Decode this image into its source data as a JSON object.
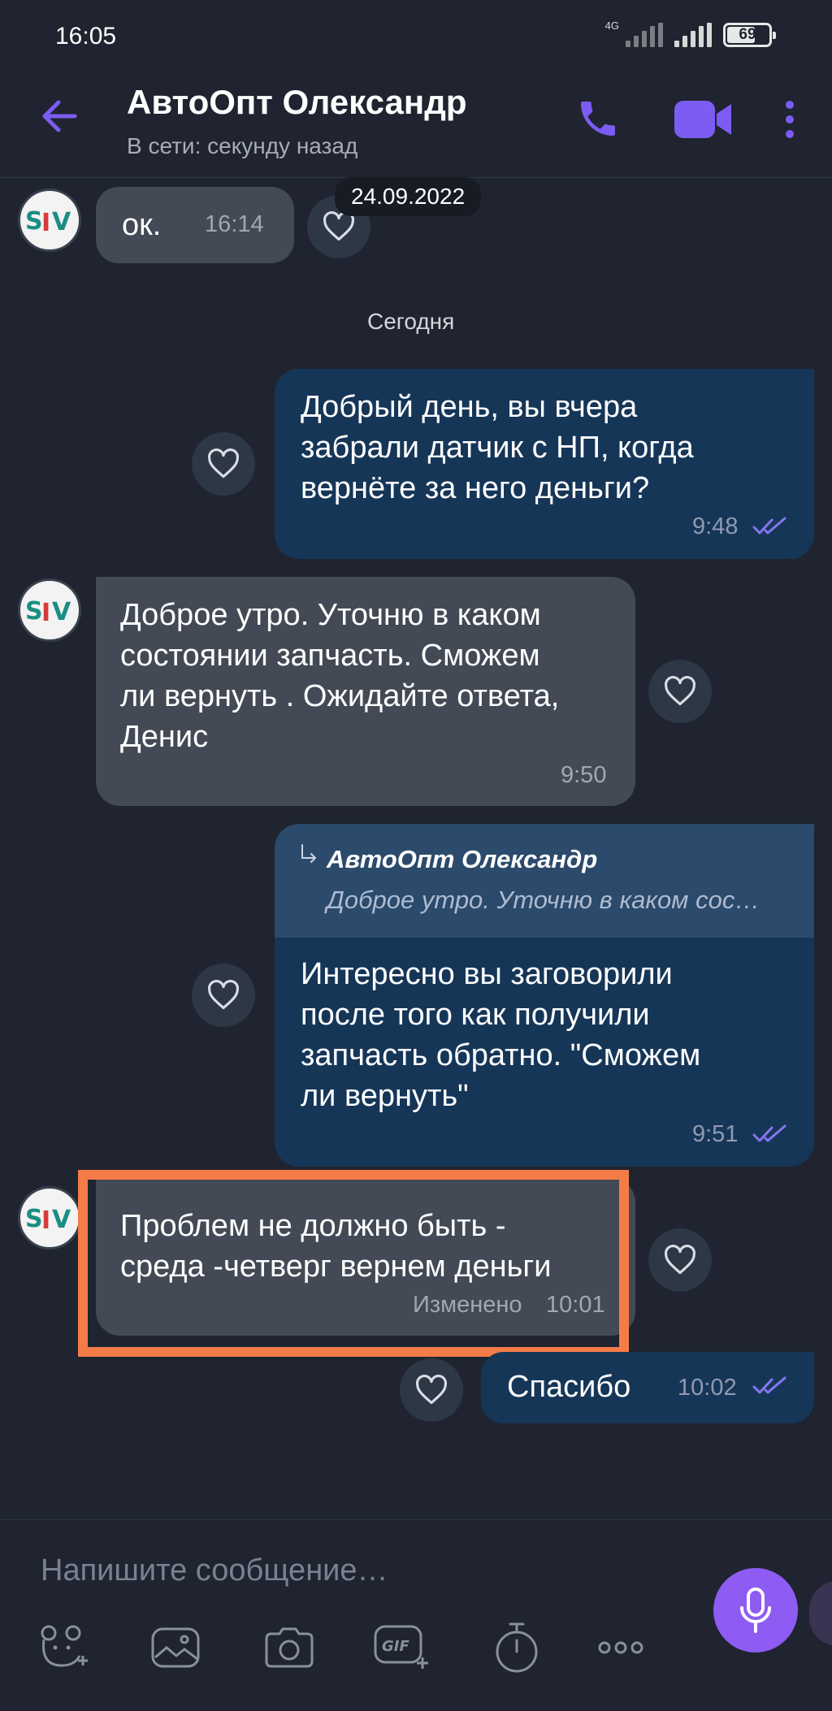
{
  "status_bar": {
    "time": "16:05",
    "network": "4G",
    "battery": "69"
  },
  "header": {
    "contact_name": "АвтоОпт Олександр",
    "presence": "В сети: секунду назад",
    "icons": [
      "back-arrow-icon",
      "phone-icon",
      "video-camera-icon",
      "more-vertical-icon"
    ],
    "accent_color": "#7c5cf2"
  },
  "date_chip": "24.09.2022",
  "day_separator": "Сегодня",
  "messages": [
    {
      "direction": "in",
      "text": "ок.",
      "time": "16:14"
    },
    {
      "direction": "out",
      "lines": [
        "Добрый день, вы вчера",
        "забрали датчик с НП, когда",
        "вернёте за него деньги?"
      ],
      "time": "9:48",
      "status": "read"
    },
    {
      "direction": "in",
      "lines": [
        "Доброе утро. Уточню  в каком",
        "состоянии  запчасть. Сможем",
        "ли вернуть . Ожидайте ответа,",
        "Денис"
      ],
      "time": "9:50"
    },
    {
      "direction": "out",
      "reply_to": {
        "name": "АвтоОпт Олександр",
        "snippet": "Доброе утро. Уточню  в каком сос…"
      },
      "lines": [
        "Интересно вы заговорили",
        "после того как получили",
        "запчасть обратно. \"Сможем",
        "ли вернуть\""
      ],
      "time": "9:51",
      "status": "read"
    },
    {
      "direction": "in",
      "lines": [
        "Проблем не должно  быть -",
        "среда -четверг вернем деньги"
      ],
      "edited_label": "Изменено",
      "time": "10:01",
      "highlighted": true
    },
    {
      "direction": "out",
      "text": "Спасибо",
      "time": "10:02",
      "status": "read"
    }
  ],
  "composer": {
    "placeholder": "Напишите сообщение…",
    "tools": [
      "sticker-icon",
      "gallery-icon",
      "camera-icon",
      "gif-icon",
      "timer-icon",
      "more-horizontal-icon"
    ],
    "send_icon": "microphone-icon"
  },
  "colors": {
    "background": "#1f2430",
    "incoming_bubble": "#434a56",
    "outgoing_bubble": "#163658",
    "highlight_border": "#f47c49"
  }
}
